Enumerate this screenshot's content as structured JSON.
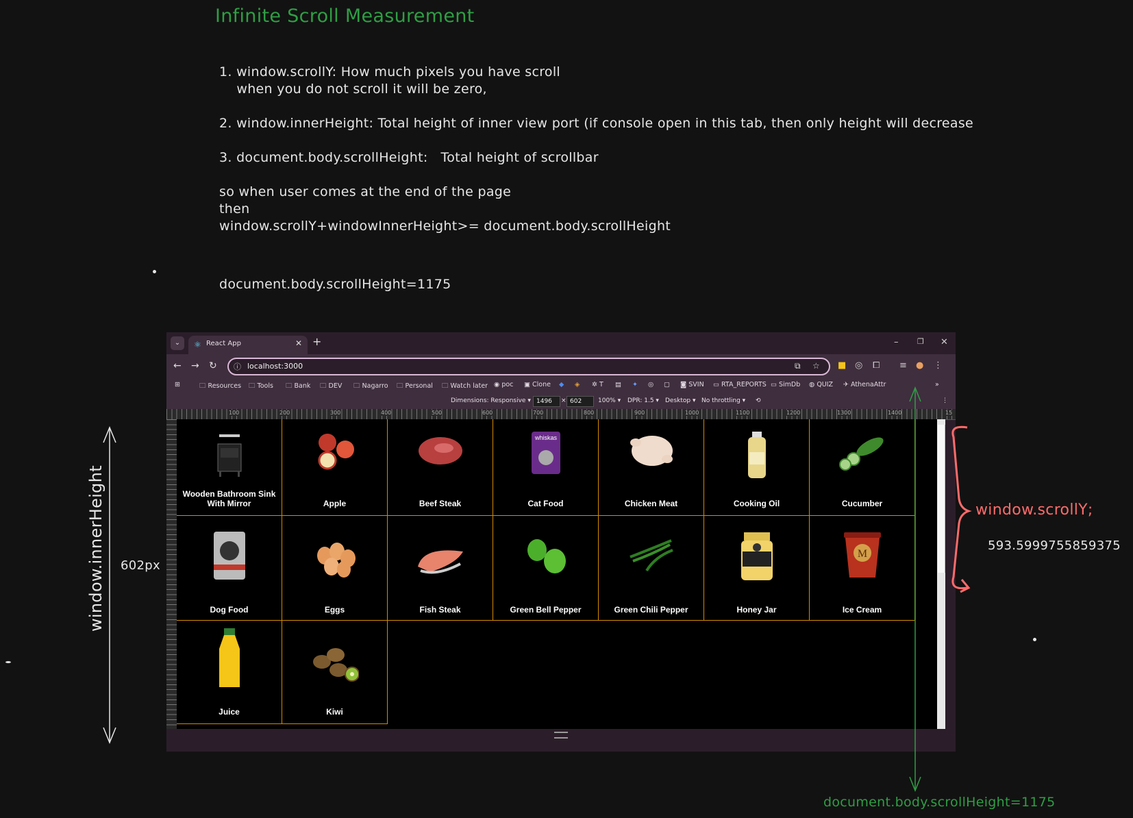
{
  "title": "Infinite Scroll Measurement",
  "notes": {
    "line1": "1. window.scrollY: How much pixels you have scroll",
    "line1b": "    when you do not scroll it will be zero,",
    "line2": "2. window.innerHeight: Total height of inner view port (if console open in this tab, then only height will decrease",
    "line3": "3. document.body.scrollHeight:   Total height of scrollbar",
    "line4": "so when user comes at the end of the page",
    "line5": "then",
    "line6": "window.scrollY+windowInnerHeight>= document.body.scrollHeight",
    "line7": "document.body.scrollHeight=1175"
  },
  "annotations": {
    "inner_height_label": "window.innerHeight",
    "inner_height_value": "602px",
    "scrolly_label": "window.scrollY;",
    "scrolly_value": "593.5999755859375",
    "scroll_height_label": "document.body.scrollHeight=1175",
    "colors": {
      "red": "#ff6b6b",
      "green": "#2f9e44",
      "white": "#e6e6e6"
    }
  },
  "browser": {
    "tab_title": "React App",
    "url": "localhost:3000",
    "bookmarks": [
      "Resources",
      "Tools",
      "Bank",
      "DEV",
      "Nagarro",
      "Personal",
      "Watch later",
      "poc",
      "Clone",
      "T",
      "SVIN",
      "RTA_REPORTS",
      "SimDb",
      "QUIZ",
      "AthenaAttr"
    ],
    "devtools": {
      "dimensions": "Dimensions: Responsive ▾",
      "width": "1496",
      "height": "602",
      "zoom": "100% ▾",
      "dpr": "DPR: 1.5 ▾",
      "device": "Desktop ▾",
      "throttle": "No throttling ▾"
    },
    "ruler_labels": [
      "100",
      "200",
      "300",
      "400",
      "500",
      "600",
      "700",
      "800",
      "900",
      "1000",
      "1100",
      "1200",
      "1300",
      "1400",
      "15"
    ]
  },
  "products": [
    {
      "name": "Wooden Bathroom Sink With Mirror",
      "icon": "sink-icon"
    },
    {
      "name": "Apple",
      "icon": "apple-icon"
    },
    {
      "name": "Beef Steak",
      "icon": "steak-icon"
    },
    {
      "name": "Cat Food",
      "icon": "cat-food-icon"
    },
    {
      "name": "Chicken Meat",
      "icon": "chicken-icon"
    },
    {
      "name": "Cooking Oil",
      "icon": "oil-bottle-icon"
    },
    {
      "name": "Cucumber",
      "icon": "cucumber-icon"
    },
    {
      "name": "Dog Food",
      "icon": "dog-food-icon"
    },
    {
      "name": "Eggs",
      "icon": "eggs-icon"
    },
    {
      "name": "Fish Steak",
      "icon": "fish-icon"
    },
    {
      "name": "Green Bell Pepper",
      "icon": "bell-pepper-icon"
    },
    {
      "name": "Green Chili Pepper",
      "icon": "chili-icon"
    },
    {
      "name": "Honey Jar",
      "icon": "honey-jar-icon"
    },
    {
      "name": "Ice Cream",
      "icon": "ice-cream-icon"
    },
    {
      "name": "Juice",
      "icon": "juice-bottle-icon"
    },
    {
      "name": "Kiwi",
      "icon": "kiwi-icon"
    }
  ]
}
